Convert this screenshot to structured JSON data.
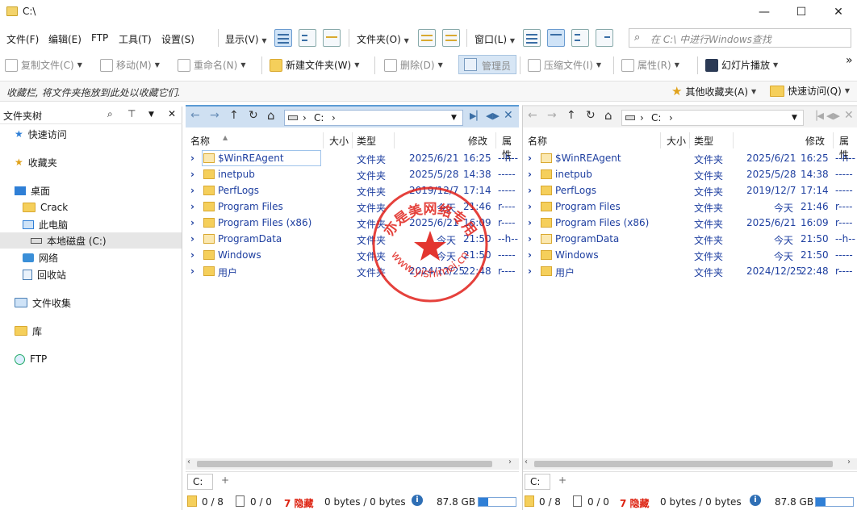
{
  "window": {
    "title": "C:\\",
    "minimize": "—",
    "maximize": "☐",
    "close": "✕"
  },
  "menu": {
    "file": "文件(F)",
    "edit": "编辑(E)",
    "ftp": "FTP",
    "tools": "工具(T)",
    "settings": "设置(S)",
    "display": "显示(V)",
    "folder": "文件夹(O)",
    "window": "窗口(L)"
  },
  "search": {
    "placeholder": "在 C:\\ 中进行Windows查找"
  },
  "toolbar": {
    "copy": "复制文件(C)",
    "move": "移动(M)",
    "rename": "重命名(N)",
    "new_folder": "新建文件夹(W)",
    "delete": "删除(D)",
    "admin": "管理员",
    "compress": "压缩文件(I)",
    "properties": "属性(R)",
    "slideshow": "幻灯片播放",
    "more": "»"
  },
  "favbar": {
    "hint": "收藏栏, 将文件夹拖放到此处以收藏它们.",
    "other_favorites": "其他收藏夹(A)",
    "quick_access": "快速访问(Q)"
  },
  "tree": {
    "title": "文件夹树",
    "items": [
      "快速访问",
      "收藏夹",
      "桌面",
      "Crack",
      "此电脑",
      "本地磁盘 (C:)",
      "网络",
      "回收站",
      "文件收集",
      "库",
      "FTP"
    ]
  },
  "columns": {
    "name": "名称",
    "size": "大小",
    "type": "类型",
    "modified": "修改",
    "attrs": "属性"
  },
  "address": {
    "drive": "C:",
    "sep": "›"
  },
  "left_pane": {
    "rows": [
      {
        "name": "$WinREAgent",
        "type": "文件夹",
        "date": "2025/6/21",
        "time": "16:25",
        "attr": "--h--"
      },
      {
        "name": "inetpub",
        "type": "文件夹",
        "date": "2025/5/28",
        "time": "14:38",
        "attr": "-----"
      },
      {
        "name": "PerfLogs",
        "type": "文件夹",
        "date": "2019/12/7",
        "time": "17:14",
        "attr": "-----"
      },
      {
        "name": "Program Files",
        "type": "文件夹",
        "date": "今天",
        "time": "21:46",
        "attr": "r----"
      },
      {
        "name": "Program Files (x86)",
        "type": "文件夹",
        "date": "2025/6/21",
        "time": "16:09",
        "attr": "r----"
      },
      {
        "name": "ProgramData",
        "type": "文件夹",
        "date": "今天",
        "time": "21:50",
        "attr": "--h--"
      },
      {
        "name": "Windows",
        "type": "文件夹",
        "date": "今天",
        "time": "21:50",
        "attr": "-----"
      },
      {
        "name": "用户",
        "type": "文件夹",
        "date": "2024/12/25",
        "time": "22:48",
        "attr": "r----"
      }
    ]
  },
  "right_pane": {
    "rows": [
      {
        "name": "$WinREAgent",
        "type": "文件夹",
        "date": "2025/6/21",
        "time": "16:25",
        "attr": "--h--"
      },
      {
        "name": "inetpub",
        "type": "文件夹",
        "date": "2025/5/28",
        "time": "14:38",
        "attr": "-----"
      },
      {
        "name": "PerfLogs",
        "type": "文件夹",
        "date": "2019/12/7",
        "time": "17:14",
        "attr": "-----"
      },
      {
        "name": "Program Files",
        "type": "文件夹",
        "date": "今天",
        "time": "21:46",
        "attr": "r----"
      },
      {
        "name": "Program Files (x86)",
        "type": "文件夹",
        "date": "2025/6/21",
        "time": "16:09",
        "attr": "r----"
      },
      {
        "name": "ProgramData",
        "type": "文件夹",
        "date": "今天",
        "time": "21:50",
        "attr": "--h--"
      },
      {
        "name": "Windows",
        "type": "文件夹",
        "date": "今天",
        "time": "21:50",
        "attr": "-----"
      },
      {
        "name": "用户",
        "type": "文件夹",
        "date": "2024/12/25",
        "time": "22:48",
        "attr": "r----"
      }
    ]
  },
  "tab": {
    "label": "C:",
    "add": "+"
  },
  "status": {
    "folders": "0 / 8",
    "files": "0 / 0",
    "hidden": "7 隐藏",
    "bytes": "0 bytes / 0 bytes",
    "free": "87.8 GB",
    "disk_used_fraction": 0.25
  },
  "watermark": {
    "text": "亦是美网络专用",
    "url": "www.yishimei.cn"
  },
  "colors": {
    "accent": "#2f7fd6",
    "link": "#1e3fa0",
    "stamp": "#e0201a",
    "hidden": "#dd2211"
  }
}
